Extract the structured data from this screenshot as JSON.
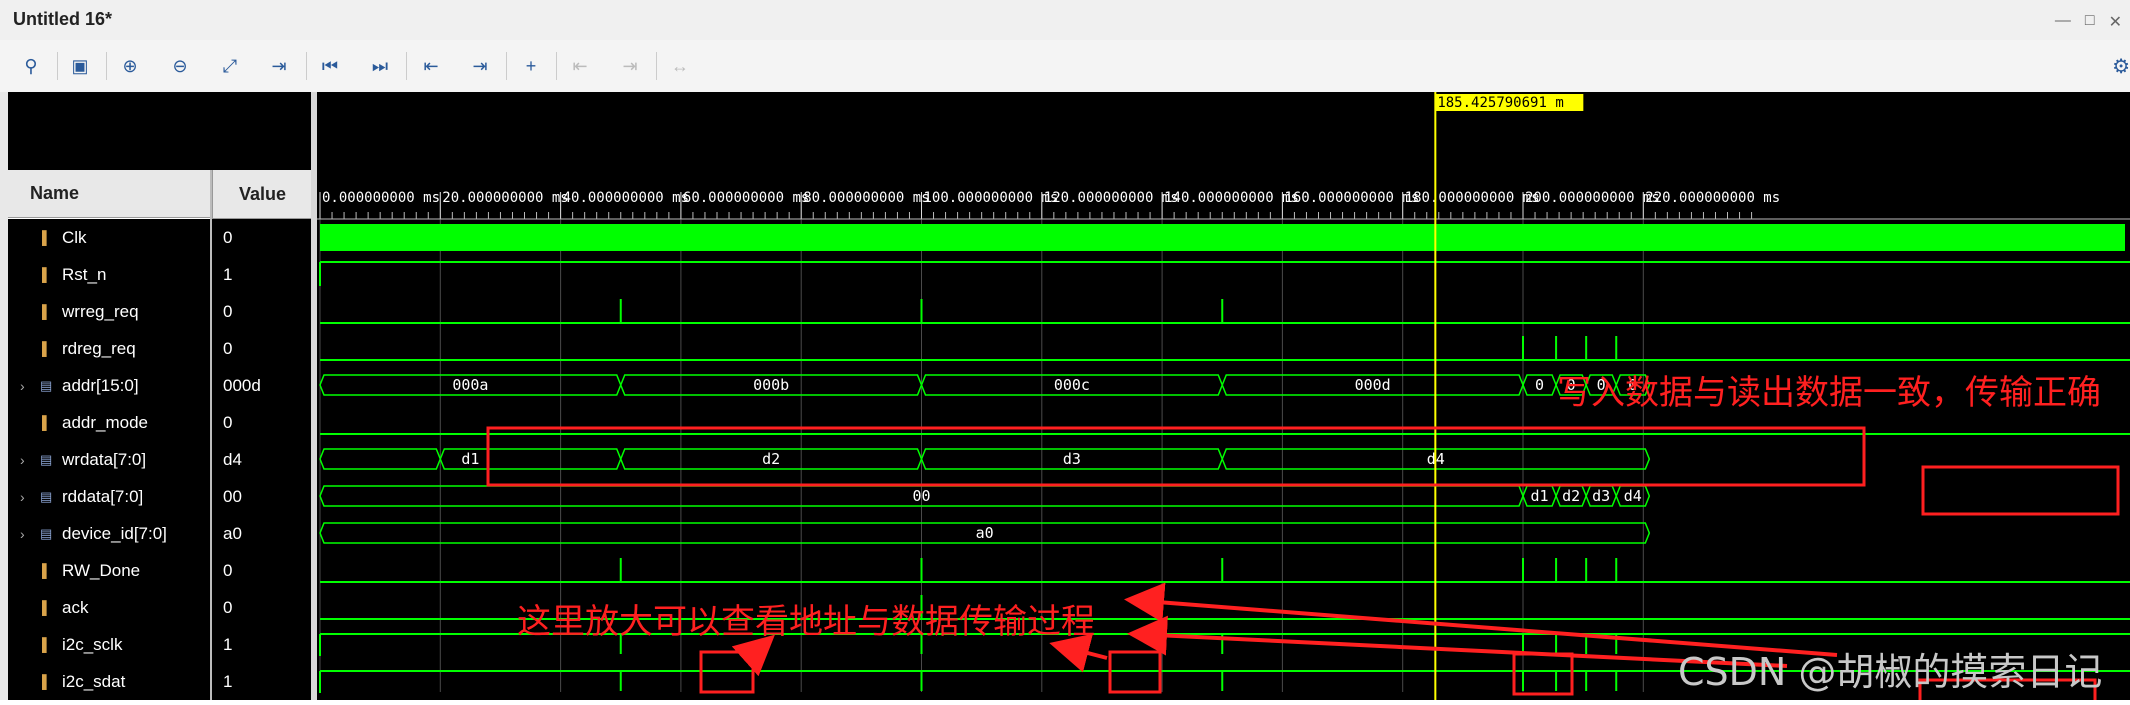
{
  "window": {
    "title": "Untitled 16*",
    "buttons": [
      "minimize-icon",
      "maximize-icon",
      "close-icon"
    ]
  },
  "toolbar": {
    "icons": [
      "search-icon",
      "save-icon",
      "zoom-in-icon",
      "zoom-out-icon",
      "zoom-fit-icon",
      "go-to-cursor-icon",
      "go-to-time-zero-icon",
      "go-to-last-time-icon",
      "previous-transition-icon",
      "next-transition-icon",
      "add-marker-icon",
      "previous-marker-icon",
      "next-marker-icon",
      "swap-cursors-icon",
      "settings-icon"
    ]
  },
  "columns": {
    "name": "Name",
    "value": "Value"
  },
  "signals": [
    {
      "name": "Clk",
      "value": "0",
      "bus": false
    },
    {
      "name": "Rst_n",
      "value": "1",
      "bus": false
    },
    {
      "name": "wrreg_req",
      "value": "0",
      "bus": false
    },
    {
      "name": "rdreg_req",
      "value": "0",
      "bus": false
    },
    {
      "name": "addr[15:0]",
      "value": "000d",
      "bus": true
    },
    {
      "name": "addr_mode",
      "value": "0",
      "bus": false
    },
    {
      "name": "wrdata[7:0]",
      "value": "d4",
      "bus": true
    },
    {
      "name": "rddata[7:0]",
      "value": "00",
      "bus": true
    },
    {
      "name": "device_id[7:0]",
      "value": "a0",
      "bus": true
    },
    {
      "name": "RW_Done",
      "value": "0",
      "bus": false
    },
    {
      "name": "ack",
      "value": "0",
      "bus": false
    },
    {
      "name": "i2c_sclk",
      "value": "1",
      "bus": false
    },
    {
      "name": "i2c_sdat",
      "value": "1",
      "bus": false
    }
  ],
  "timeline": {
    "cursor_label": "185.425790691 m",
    "cursor_time_ms": 185.425790691,
    "ticks": [
      "0.000000000 ms",
      "20.000000000 ms",
      "40.000000000 ms",
      "60.000000000 ms",
      "80.000000000 ms",
      "100.000000000 ms",
      "120.000000000 ms",
      "140.000000000 ms",
      "160.000000000 ms",
      "180.000000000 ms",
      "200.000000000 ms",
      "220.000000000 ms"
    ]
  },
  "bus_segments": {
    "addr": [
      "000a",
      "000b",
      "000c",
      "000d",
      "0",
      "0",
      "0",
      "0"
    ],
    "wrdata": [
      "d1",
      "d2",
      "d3",
      "d4"
    ],
    "rddata": [
      "00",
      "d1",
      "d2",
      "d3",
      "d4"
    ],
    "device_id": [
      "a0"
    ]
  },
  "annotations": {
    "top_right": "写入数据与读出数据一致，传输正确",
    "bottom": "这里放大可以查看地址与数据传输过程",
    "color": "#ff2020"
  },
  "watermark": "CSDN @胡椒的摸索日记",
  "colors": {
    "waveform": "#00ff00",
    "cursor": "#ffff00",
    "background": "#000000"
  }
}
